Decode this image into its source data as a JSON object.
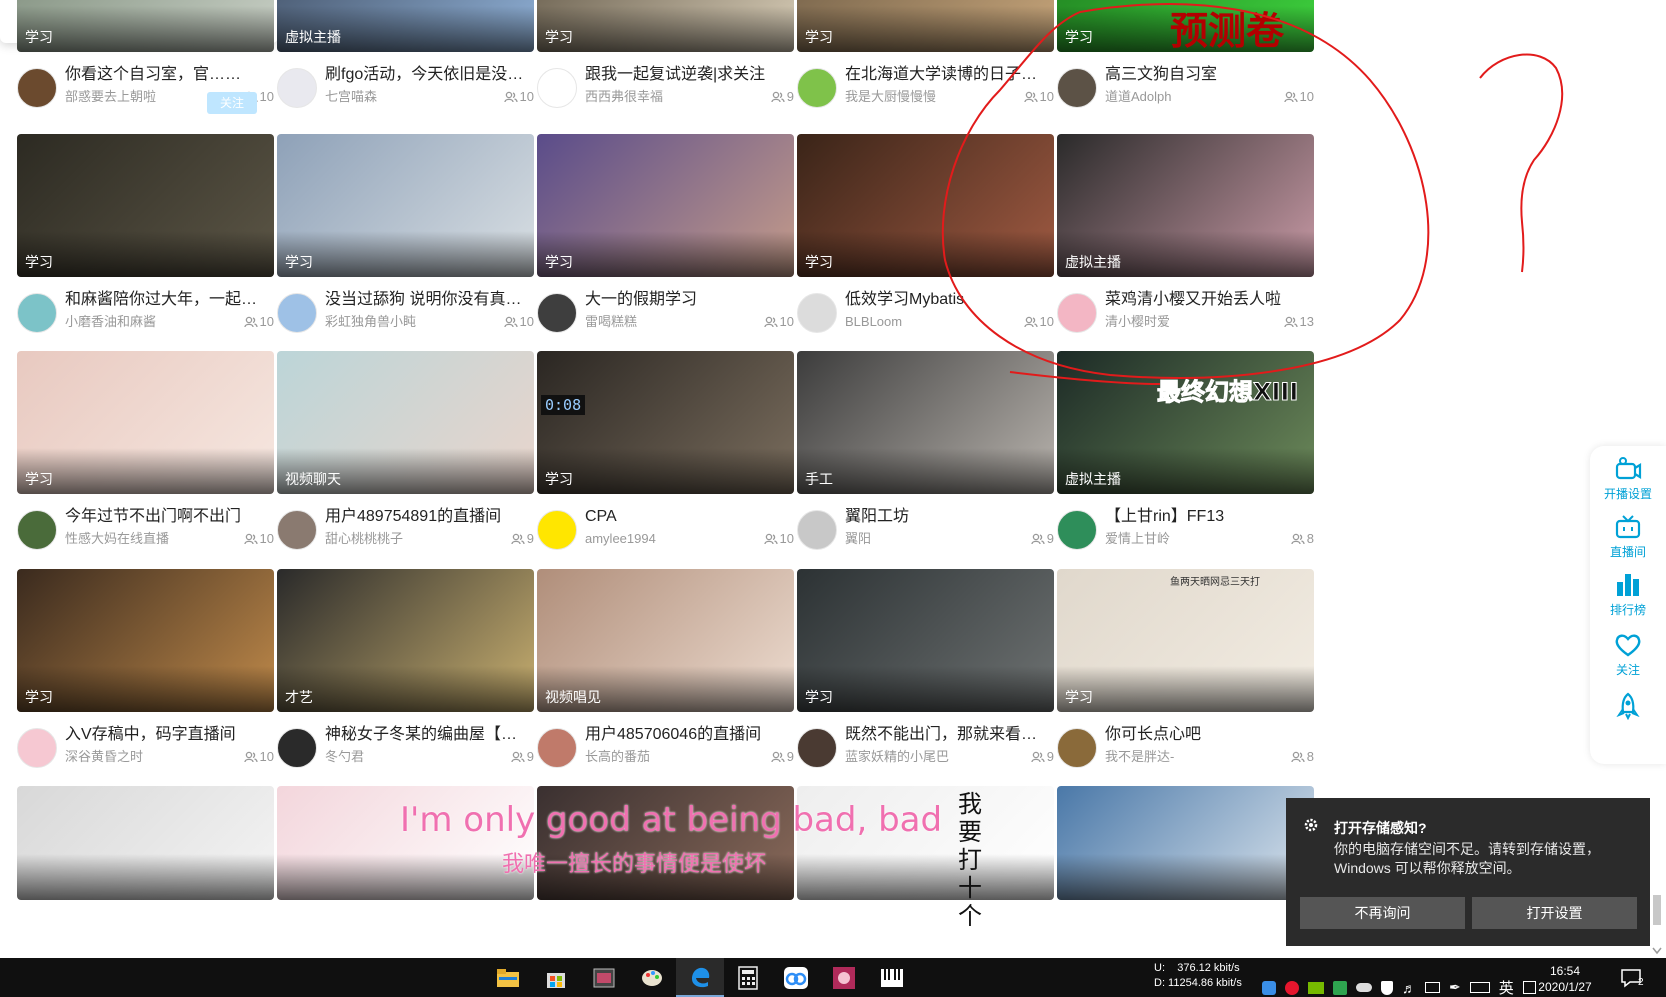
{
  "cards": [
    {
      "tag": "学习",
      "title": "你看这个自习室，官……",
      "anchor": "部惑要去上朝啦",
      "count": "10",
      "avatar": "#6b4a2e",
      "thumb": [
        "#7a8a78",
        "#c9d0c6"
      ]
    },
    {
      "tag": "虚拟主播",
      "title": "刷fgo活动，今天依旧是没…",
      "anchor": "七宫喵森",
      "count": "10",
      "avatar": "#e9e9ef",
      "thumb": [
        "#3d4a5e",
        "#8fb0d6"
      ]
    },
    {
      "tag": "学习",
      "title": "跟我一起复试逆袭|求关注",
      "anchor": "西西弗很幸福",
      "count": "9",
      "avatar": "#ffffff",
      "thumb": [
        "#5a5040",
        "#d8cdb7"
      ]
    },
    {
      "tag": "学习",
      "title": "在北海道大学读博的日子（…",
      "anchor": "我是大厨慢慢慢",
      "count": "10",
      "avatar": "#7fc24a",
      "thumb": [
        "#6b5a44",
        "#c7a57a"
      ]
    },
    {
      "tag": "学习",
      "title": "高三文狗自习室",
      "anchor": "道道Adolph",
      "count": "10",
      "avatar": "#5c5246",
      "thumb": [
        "#1e7a1e",
        "#3ed23e"
      ]
    },
    {
      "tag": "学习",
      "title": "和麻酱陪你过大年，一起自…",
      "anchor": "小磨香油和麻酱",
      "count": "10",
      "avatar": "#7cc3c8",
      "thumb": [
        "#2c2a22",
        "#5c5646"
      ]
    },
    {
      "tag": "学习",
      "title": "没当过舔狗 说明你没有真…",
      "anchor": "彩虹独角兽小盹",
      "count": "10",
      "avatar": "#9ec1e6",
      "thumb": [
        "#8ea1b8",
        "#d9dfe3"
      ]
    },
    {
      "tag": "学习",
      "title": "大一的假期学习",
      "anchor": "雷喝糕糕",
      "count": "10",
      "avatar": "#3e3e3e",
      "thumb": [
        "#5a4c8a",
        "#c59c8a"
      ]
    },
    {
      "tag": "学习",
      "title": "低效学习Mybatis",
      "anchor": "BLBLoom",
      "count": "10",
      "avatar": "#dcdcdc",
      "thumb": [
        "#3a2418",
        "#a05a42"
      ]
    },
    {
      "tag": "虚拟主播",
      "title": "菜鸡清小樱又开始丢人啦",
      "anchor": "清小樱时爱",
      "count": "13",
      "avatar": "#f3b6c4",
      "thumb": [
        "#2a2a2a",
        "#c99aa6"
      ]
    },
    {
      "tag": "学习",
      "title": "今年过节不出门啊不出门",
      "anchor": "性感大妈在线直播",
      "count": "10",
      "avatar": "#4a6b3a",
      "thumb": [
        "#e8c9c0",
        "#f6e7e0"
      ]
    },
    {
      "tag": "视频聊天",
      "title": "用户489754891的直播间",
      "anchor": "甜心桃桃桃子",
      "count": "9",
      "avatar": "#8a7a70",
      "thumb": [
        "#bcd5d8",
        "#e9d5cc"
      ]
    },
    {
      "tag": "学习",
      "title": "CPA",
      "anchor": "amylee1994",
      "count": "10",
      "avatar": "#ffe600",
      "thumb": [
        "#2a2622",
        "#7b6e5e"
      ]
    },
    {
      "tag": "手工",
      "title": "翼阳工坊",
      "anchor": "翼阳",
      "count": "9",
      "avatar": "#c8c8c8",
      "thumb": [
        "#3c3c3c",
        "#b9b4ae"
      ]
    },
    {
      "tag": "虚拟主播",
      "title": "【上甘rin】FF13",
      "anchor": "爱情上甘岭",
      "count": "8",
      "avatar": "#2e8e5a",
      "thumb": [
        "#1c2a26",
        "#6c8a5a"
      ]
    },
    {
      "tag": "学习",
      "title": "入V存稿中，码字直播间",
      "anchor": "深谷黄昏之时",
      "count": "10",
      "avatar": "#f6c8d2",
      "thumb": [
        "#3a2a1e",
        "#c08a4a"
      ]
    },
    {
      "tag": "才艺",
      "title": "神秘女子冬某的编曲屋【真…",
      "anchor": "冬勺君",
      "count": "9",
      "avatar": "#2a2a2a",
      "thumb": [
        "#2a2a2a",
        "#c9b070"
      ]
    },
    {
      "tag": "视频唱见",
      "title": "用户485706046的直播间",
      "anchor": "长高的番茄",
      "count": "9",
      "avatar": "#c07a6a",
      "thumb": [
        "#b08e7a",
        "#eddcd0"
      ]
    },
    {
      "tag": "学习",
      "title": "既然不能出门，那就来看我…",
      "anchor": "蓝家妖精的小尾巴",
      "count": "9",
      "avatar": "#4a3a32",
      "thumb": [
        "#2c3234",
        "#6e7272"
      ]
    },
    {
      "tag": "学习",
      "title": "你可长点心吧",
      "anchor": "我不是胖达-",
      "count": "8",
      "avatar": "#8a6a3a",
      "thumb": [
        "#e0d8cc",
        "#f2ece2"
      ]
    },
    {
      "tag": "",
      "title": "",
      "anchor": "",
      "count": "",
      "avatar": "",
      "thumb": [
        "#d8d8d8",
        "#f4f4f4"
      ]
    },
    {
      "tag": "",
      "title": "",
      "anchor": "",
      "count": "",
      "avatar": "",
      "thumb": [
        "#f3d6dc",
        "#ffffff"
      ]
    },
    {
      "tag": "",
      "title": "",
      "anchor": "",
      "count": "",
      "avatar": "",
      "thumb": [
        "#3a3030",
        "#8a6a5a"
      ]
    },
    {
      "tag": "",
      "title": "",
      "anchor": "",
      "count": "",
      "avatar": "",
      "thumb": [
        "#eeeeee",
        "#ffffff"
      ]
    },
    {
      "tag": "",
      "title": "",
      "anchor": "",
      "count": "",
      "avatar": "",
      "thumb": [
        "#4a78a8",
        "#dde6ee"
      ]
    }
  ],
  "overlay_text": {
    "banner": "预测卷",
    "ff_title": "最终幻想XIII",
    "time_display": "0:08",
    "lyric_en": "I'm only good at being bad, bad",
    "lyric_zh": "我唯一擅长的事情便是使坏",
    "calligraphy": "我要打十个",
    "note": "鱼两天晒网忌三天打"
  },
  "popup": {
    "follow_label": "关注"
  },
  "sidebar": [
    {
      "label": "开播设置",
      "icon": "camera-icon"
    },
    {
      "label": "直播间",
      "icon": "tv-icon"
    },
    {
      "label": "排行榜",
      "icon": "chart-icon"
    },
    {
      "label": "关注",
      "icon": "heart-icon"
    },
    {
      "label": "",
      "icon": "rocket-icon"
    }
  ],
  "toast": {
    "title": "打开存储感知?",
    "body": "你的电脑存储空间不足。请转到存储设置，Windows 可以帮你释放空间。",
    "btn_dismiss": "不再询问",
    "btn_open": "打开设置"
  },
  "taskbar": {
    "upload": "U:    376.12 kbit/s",
    "download": "D: 11254.86 kbit/s",
    "ime": "英",
    "time": "16:54",
    "date": "2020/1/27",
    "notifications": "2"
  }
}
